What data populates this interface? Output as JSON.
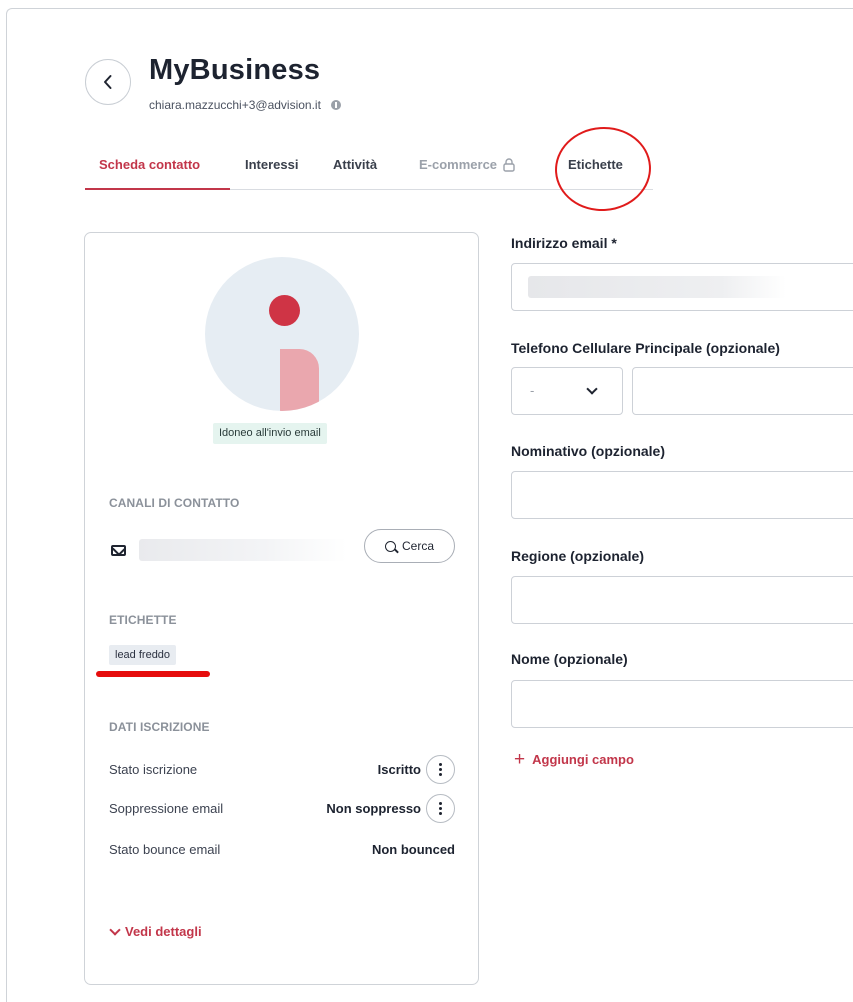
{
  "header": {
    "title": "MyBusiness",
    "email": "chiara.mazzucchi+3@advision.it"
  },
  "tabs": [
    {
      "label": "Scheda contatto",
      "active": true
    },
    {
      "label": "Interessi"
    },
    {
      "label": "Attività"
    },
    {
      "label": "E-commerce",
      "locked": true
    },
    {
      "label": "Etichette"
    }
  ],
  "profile": {
    "status_badge": "Idoneo all'invio email",
    "contact_channels_title": "CANALI DI CONTATTO",
    "search_button": "Cerca",
    "tags_title": "ETICHETTE",
    "tags": [
      "lead freddo"
    ],
    "subscription_title": "DATI ISCRIZIONE",
    "rows": [
      {
        "label": "Stato iscrizione",
        "value": "Iscritto"
      },
      {
        "label": "Soppressione email",
        "value": "Non soppresso"
      },
      {
        "label": "Stato bounce email",
        "value": "Non bounced"
      }
    ],
    "details_link": "Vedi dettagli"
  },
  "form": {
    "email_label": "Indirizzo email *",
    "phone_label": "Telefono Cellulare Principale (opzionale)",
    "phone_prefix": "-",
    "name_full_label": "Nominativo (opzionale)",
    "region_label": "Regione (opzionale)",
    "first_name_label": "Nome (opzionale)",
    "add_field": "Aggiungi campo"
  },
  "colors": {
    "accent": "#c2364a",
    "annotation_red": "#e01b1b",
    "badge_bg": "#e5f4ef",
    "avatar_bg": "#e6edf3"
  }
}
